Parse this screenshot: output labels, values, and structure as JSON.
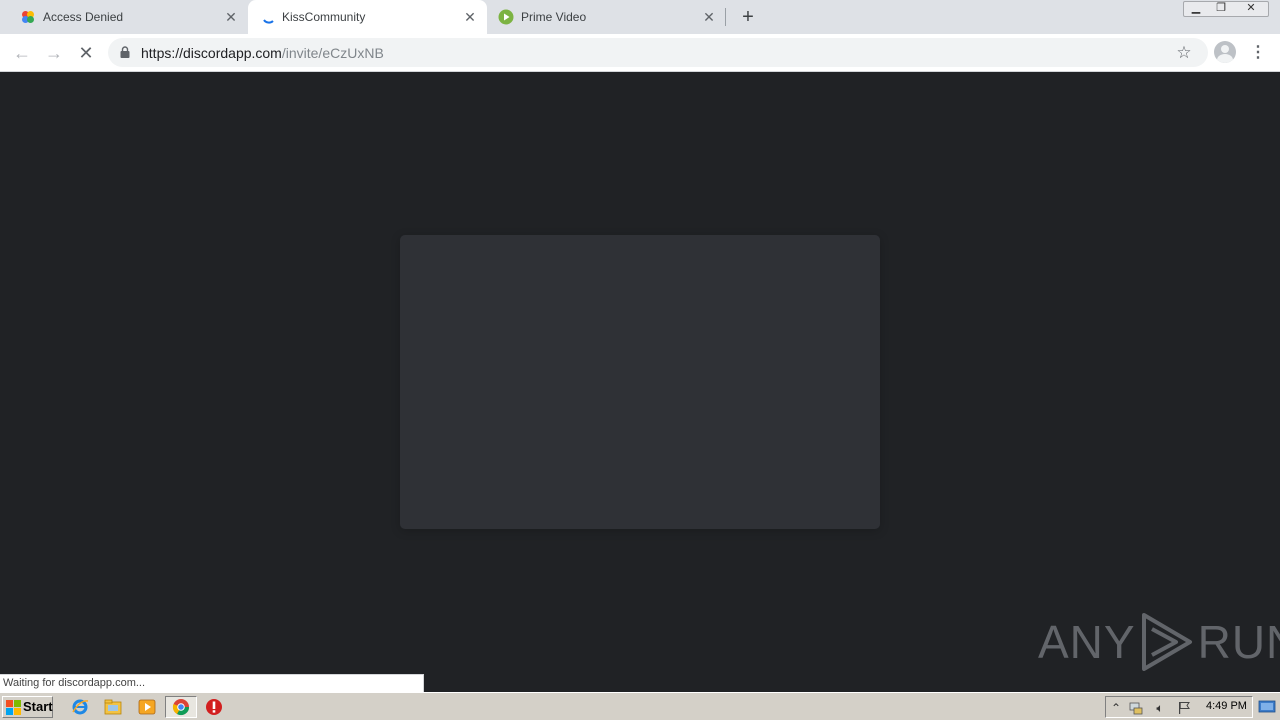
{
  "tabs": [
    {
      "title": "Access Denied",
      "icon": "google-photos-icon",
      "active": false
    },
    {
      "title": "KissCommunity",
      "icon": "loading-spinner-icon",
      "active": true
    },
    {
      "title": "Prime Video",
      "icon": "play-circle-icon",
      "active": false
    }
  ],
  "toolbar": {
    "url_scheme_host": "https://discordapp.com",
    "url_path": "/invite/eCzUxNB"
  },
  "status": {
    "text": "Waiting for discordapp.com..."
  },
  "watermark": {
    "left": "ANY",
    "right": "RUN"
  },
  "taskbar": {
    "start_label": "Start",
    "clock": "4:49 PM"
  },
  "colors": {
    "page_bg": "#202225",
    "card_bg": "#2f3136",
    "accent_blue": "#1a73e8",
    "prime_green": "#7cb342"
  }
}
